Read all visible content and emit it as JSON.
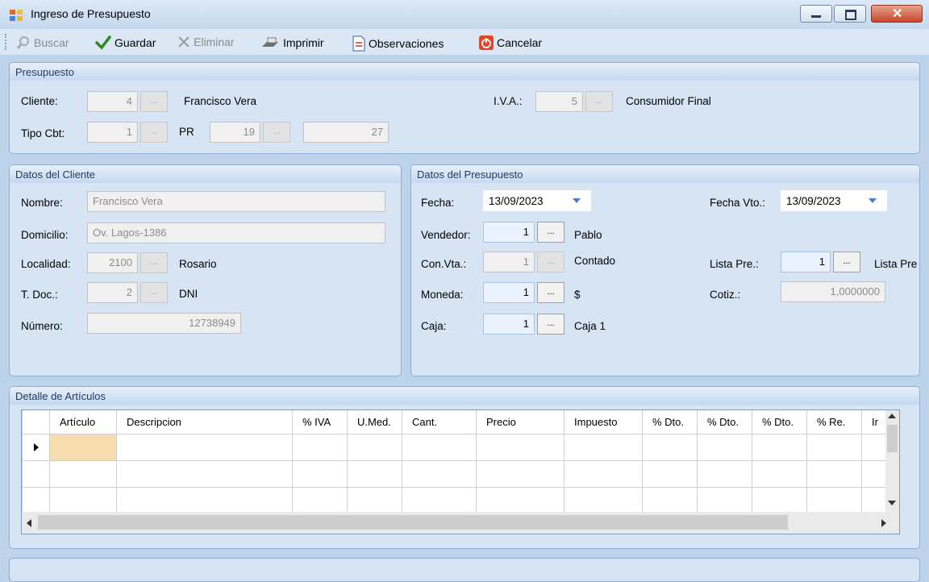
{
  "window": {
    "title": "Ingreso  de Presupuesto"
  },
  "toolbar": {
    "buscar": "Buscar",
    "guardar": "Guardar",
    "eliminar": "Eliminar",
    "imprimir": "Imprimir",
    "observaciones": "Observaciones",
    "cancelar": "Cancelar"
  },
  "presupuesto": {
    "title": "Presupuesto",
    "cliente_label": "Cliente:",
    "cliente_code": "4",
    "cliente_name": "Francisco Vera",
    "iva_label": "I.V.A.:",
    "iva_code": "5",
    "iva_name": "Consumidor Final",
    "tipo_label": "Tipo Cbt:",
    "tipo_code": "1",
    "tipo_name": "PR",
    "punto": "19",
    "numero": "27"
  },
  "cliente": {
    "title": "Datos del Cliente",
    "nombre_label": "Nombre:",
    "nombre": "Francisco Vera",
    "domicilio_label": "Domicilio:",
    "domicilio": "Ov. Lagos-1386",
    "localidad_label": "Localidad:",
    "localidad_code": "2100",
    "localidad_name": "Rosario",
    "tdoc_label": "T. Doc.:",
    "tdoc_code": "2",
    "tdoc_name": "DNI",
    "numero_label": "Número:",
    "numero": "12738949"
  },
  "datos_presupuesto": {
    "title": "Datos del Presupuesto",
    "fecha_label": "Fecha:",
    "fecha": "13/09/2023",
    "fecha_vto_label": "Fecha Vto.:",
    "fecha_vto": "13/09/2023",
    "vendedor_label": "Vendedor:",
    "vendedor_code": "1",
    "vendedor_name": "Pablo",
    "convta_label": "Con.Vta.:",
    "convta_code": "1",
    "convta_name": "Contado",
    "lista_label": "Lista Pre.:",
    "lista_code": "1",
    "lista_name": "Lista Pre",
    "moneda_label": "Moneda:",
    "moneda_code": "1",
    "moneda_name": "$",
    "cotiz_label": "Cotiz.:",
    "cotiz": "1,0000000",
    "caja_label": "Caja:",
    "caja_code": "1",
    "caja_name": "Caja 1"
  },
  "detalle": {
    "title": "Detalle de Artículos",
    "columns": [
      "",
      "Artículo",
      "Descripcion",
      "% IVA",
      "U.Med.",
      "Cant.",
      "Precio",
      "Impuesto",
      "% Dto.",
      "% Dto.",
      "% Dto.",
      "% Re.",
      "Ir"
    ]
  },
  "icons": {
    "buscar": "search-icon",
    "guardar": "check-icon",
    "eliminar": "x-icon",
    "imprimir": "printer-icon",
    "observaciones": "notes-icon",
    "cancelar": "power-icon"
  },
  "colors": {
    "selected_cell": "#f7dcaf",
    "panel": "#d6e4f4",
    "close_button": "#c9472c"
  }
}
